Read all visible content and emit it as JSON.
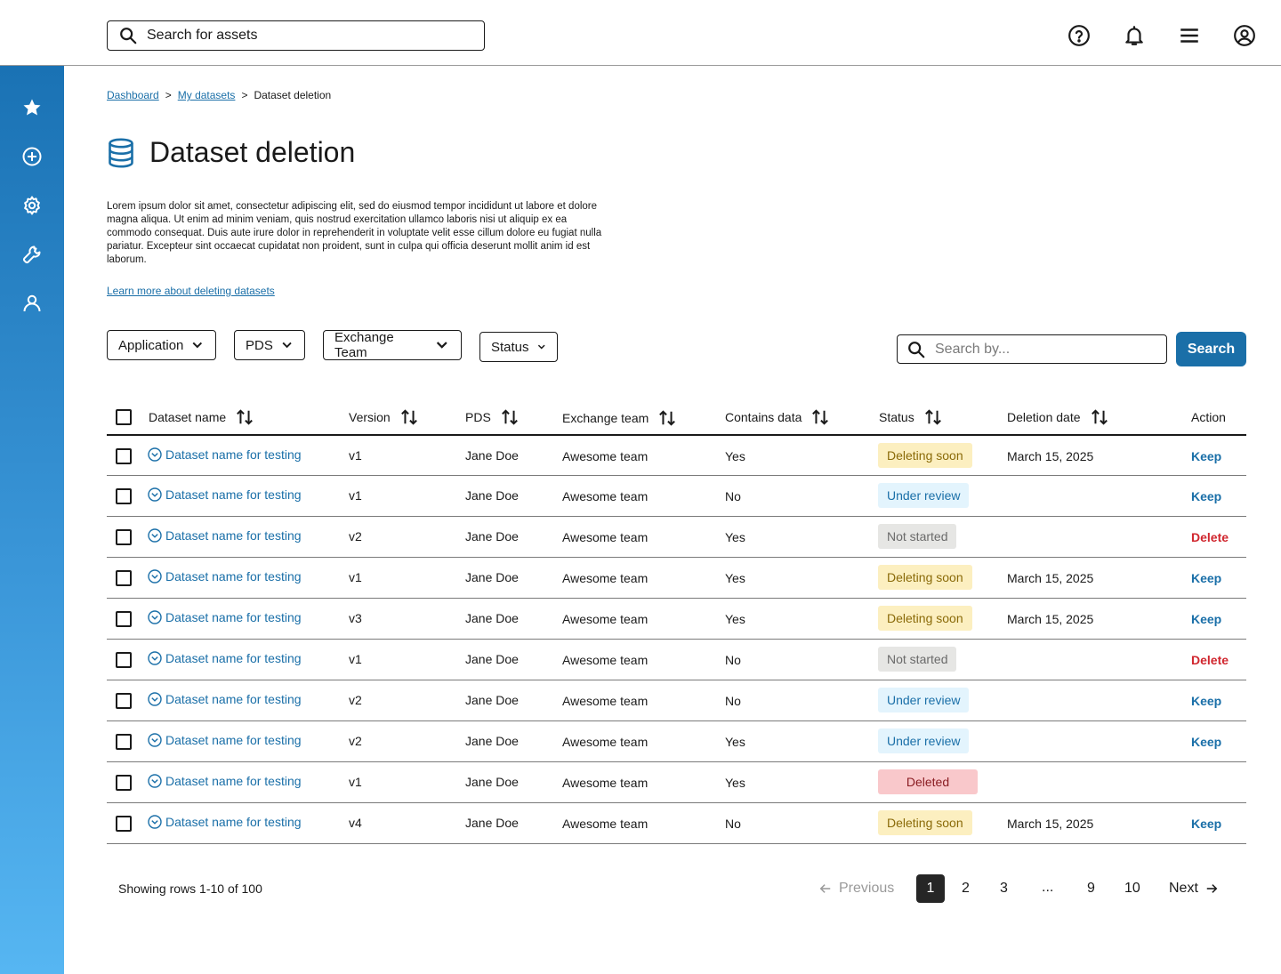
{
  "header": {
    "search_placeholder": "Search for assets"
  },
  "breadcrumb": [
    "Dashboard",
    "My datasets",
    "Dataset deletion"
  ],
  "page": {
    "title": "Dataset deletion",
    "description": "Lorem ipsum dolor sit amet, consectetur adipiscing elit, sed do eiusmod tempor incididunt ut labore et dolore magna aliqua. Ut enim ad minim veniam, quis nostrud exercitation ullamco laboris nisi ut aliquip ex ea commodo consequat. Duis aute irure dolor in reprehenderit in voluptate velit esse cillum dolore eu fugiat nulla pariatur. Excepteur sint occaecat cupidatat non proident, sunt in culpa qui officia deserunt mollit anim id est laborum.",
    "learn_more": "Learn more about deleting datasets"
  },
  "filters": [
    "Application",
    "PDS",
    "Exchange Team",
    "Status"
  ],
  "table_search": {
    "placeholder": "Search by...",
    "button": "Search"
  },
  "table": {
    "columns": [
      "Dataset name",
      "Version",
      "PDS",
      "Exchange team",
      "Contains data",
      "Status",
      "Deletion date",
      "Action"
    ],
    "rows": [
      {
        "name": "Dataset name for testing",
        "version": "v1",
        "pds": "Jane Doe",
        "team": "Awesome team",
        "contains": "Yes",
        "status": "Deleting soon",
        "status_type": "deleting",
        "date": "March 15, 2025",
        "action": "Keep",
        "action_type": "keep"
      },
      {
        "name": "Dataset name for testing",
        "version": "v1",
        "pds": "Jane Doe",
        "team": "Awesome team",
        "contains": "No",
        "status": "Under review",
        "status_type": "review",
        "date": "",
        "action": "Keep",
        "action_type": "keep"
      },
      {
        "name": "Dataset name for testing",
        "version": "v2",
        "pds": "Jane Doe",
        "team": "Awesome team",
        "contains": "Yes",
        "status": "Not started",
        "status_type": "notstarted",
        "date": "",
        "action": "Delete",
        "action_type": "delete"
      },
      {
        "name": "Dataset name for testing",
        "version": "v1",
        "pds": "Jane Doe",
        "team": "Awesome team",
        "contains": "Yes",
        "status": "Deleting soon",
        "status_type": "deleting",
        "date": "March 15, 2025",
        "action": "Keep",
        "action_type": "keep"
      },
      {
        "name": "Dataset name for testing",
        "version": "v3",
        "pds": "Jane Doe",
        "team": "Awesome team",
        "contains": "Yes",
        "status": "Deleting soon",
        "status_type": "deleting",
        "date": "March 15, 2025",
        "action": "Keep",
        "action_type": "keep"
      },
      {
        "name": "Dataset name for testing",
        "version": "v1",
        "pds": "Jane Doe",
        "team": "Awesome team",
        "contains": "No",
        "status": "Not started",
        "status_type": "notstarted",
        "date": "",
        "action": "Delete",
        "action_type": "delete"
      },
      {
        "name": "Dataset name for testing",
        "version": "v2",
        "pds": "Jane Doe",
        "team": "Awesome team",
        "contains": "No",
        "status": "Under review",
        "status_type": "review",
        "date": "",
        "action": "Keep",
        "action_type": "keep"
      },
      {
        "name": "Dataset name for testing",
        "version": "v2",
        "pds": "Jane Doe",
        "team": "Awesome team",
        "contains": "Yes",
        "status": "Under review",
        "status_type": "review",
        "date": "",
        "action": "Keep",
        "action_type": "keep"
      },
      {
        "name": "Dataset name for testing",
        "version": "v1",
        "pds": "Jane Doe",
        "team": "Awesome team",
        "contains": "Yes",
        "status": "Deleted",
        "status_type": "deleted",
        "date": "",
        "action": "",
        "action_type": "none"
      },
      {
        "name": "Dataset name for testing",
        "version": "v4",
        "pds": "Jane Doe",
        "team": "Awesome team",
        "contains": "No",
        "status": "Deleting soon",
        "status_type": "deleting",
        "date": "March 15, 2025",
        "action": "Keep",
        "action_type": "keep"
      }
    ]
  },
  "pagination": {
    "showing": "Showing rows 1-10 of 100",
    "previous": "Previous",
    "next": "Next",
    "pages": [
      "1",
      "2",
      "3",
      "...",
      "9",
      "10"
    ],
    "active": "1"
  },
  "colors": {
    "accent": "#1a6fa8",
    "danger": "#d0262e",
    "sidebar_top": "#1a72b4",
    "sidebar_bottom": "#56b6f2"
  },
  "icons": {
    "top": [
      "help-icon",
      "bell-icon",
      "menu-icon",
      "account-icon"
    ],
    "sidebar": [
      "star-icon",
      "add-circle-icon",
      "gear-icon",
      "wrench-icon",
      "user-icon"
    ]
  }
}
